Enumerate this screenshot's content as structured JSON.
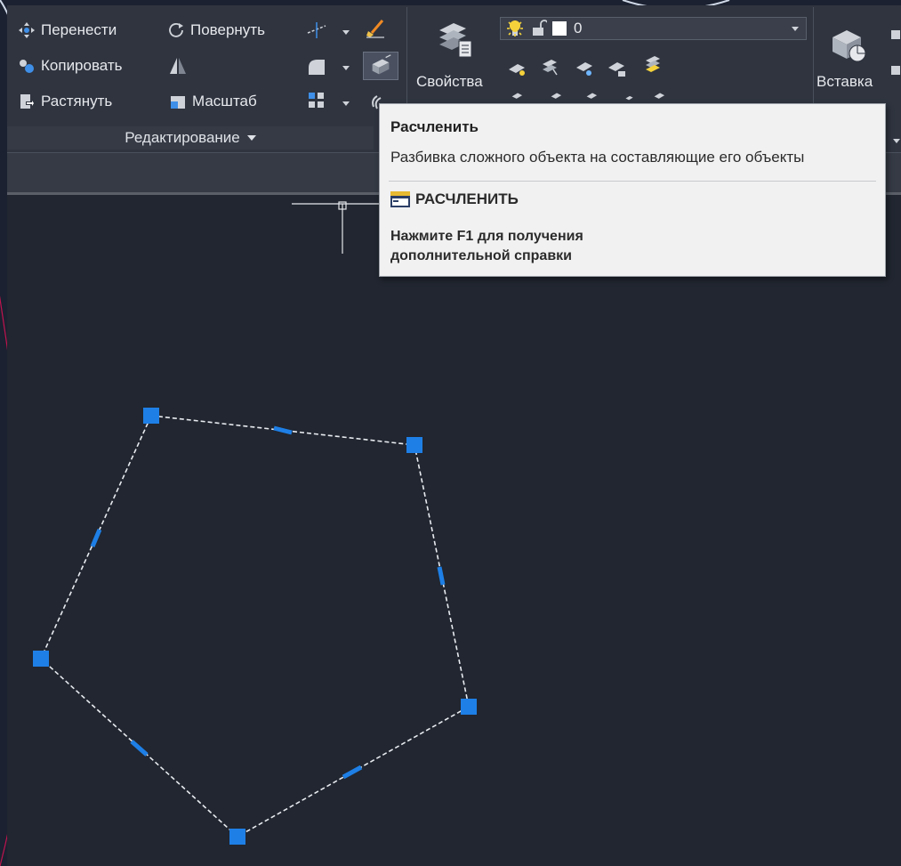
{
  "colors": {
    "slide_background": "#1b2130",
    "accent_curve": "#c1134f",
    "ribbon_background": "#2f343f",
    "drawing_area": "#212630",
    "grip": "#1e7fe6",
    "tooltip_background": "#f1f1f2"
  },
  "modify_panel": {
    "move_label": "Перенести",
    "rotate_label": "Повернуть",
    "copy_label": "Копировать",
    "stretch_label": "Растянуть",
    "scale_label": "Масштаб",
    "panel_title": "Редактирование",
    "icons": [
      "move-icon",
      "rotate-icon",
      "copy-icon",
      "mirror-icon",
      "stretch-icon",
      "scale-icon",
      "trim-icon",
      "fillet-icon",
      "array-icon",
      "erase-icon",
      "explode-icon",
      "offset-icon"
    ]
  },
  "properties_panel": {
    "properties_label": "Свойства",
    "layer_value": "0"
  },
  "insert_panel": {
    "insert_label": "Вставка"
  },
  "tooltip": {
    "title": "Расчленить",
    "description": "Разбивка сложного объекта на составляющие его объекты",
    "command": "РАСЧЛЕНИТЬ",
    "help_line1": "Нажмите F1 для получения",
    "help_line2": "дополнительной справки"
  },
  "drawing": {
    "object": "selected pentagon polyline",
    "vertex_grips": 5,
    "midpoint_grips": 5
  }
}
